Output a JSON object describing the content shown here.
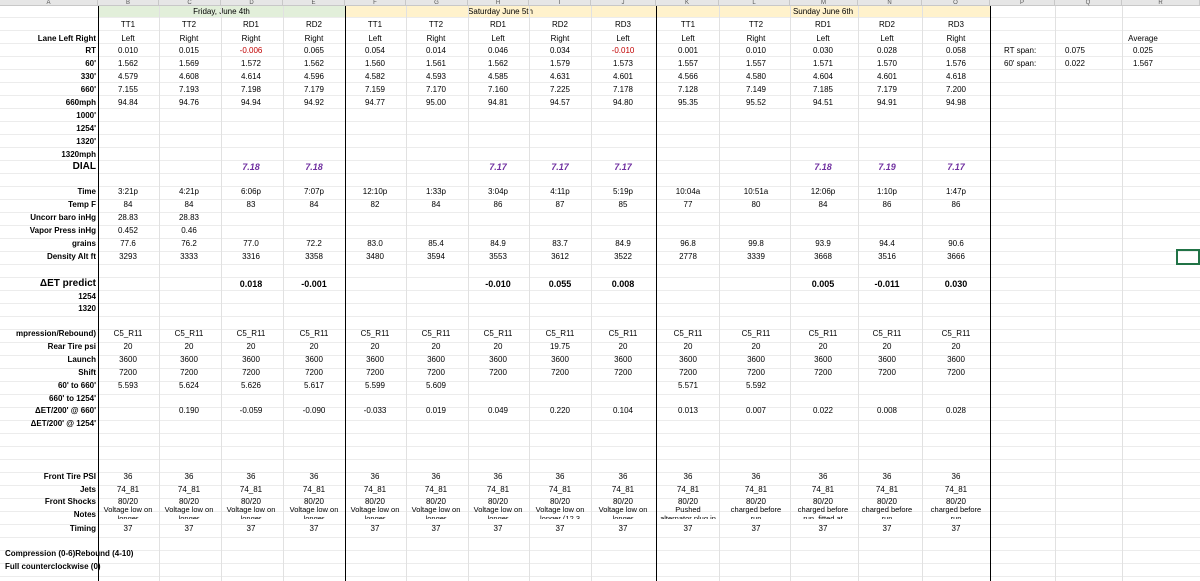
{
  "columns": [
    "A",
    "B",
    "C",
    "D",
    "E",
    "F",
    "G",
    "H",
    "I",
    "J",
    "K",
    "L",
    "M",
    "N",
    "O",
    "P",
    "Q",
    "R"
  ],
  "days": [
    {
      "label": "Friday, June 4th",
      "color": "#e2efda"
    },
    {
      "label": "Saturday June 5th",
      "color": "#fff2cc"
    },
    {
      "label": "Sunday June 6th",
      "color": "#fff2cc"
    }
  ],
  "run_headers": [
    "TT1",
    "TT2",
    "RD1",
    "RD2",
    "TT1",
    "TT2",
    "RD1",
    "RD2",
    "RD3",
    "TT1",
    "TT2",
    "RD1",
    "RD2",
    "RD3"
  ],
  "row_labels": {
    "lane": "Lane Left Right",
    "rt": "RT",
    "s60": "60'",
    "s330": "330'",
    "s660": "660'",
    "mph660": "660mph",
    "s1000": "1000'",
    "s1254": "1254'",
    "s1320": "1320'",
    "mph1320": "1320mph",
    "dial": "DIAL",
    "time": "Time",
    "temp": "Temp F",
    "baro": "Uncorr baro inHg",
    "vapor": "Vapor Press inHg",
    "grains": "grains",
    "density": "Density Alt ft",
    "et_predict": "ΔET predict",
    "r1254": "1254",
    "r1320": "1320",
    "comp": "mpression/Rebound)",
    "rear_psi": "Rear Tire psi",
    "launch": "Launch",
    "shift": "Shift",
    "s60_660": "60' to 660'",
    "s660_1254": "660' to 1254'",
    "det660": "ΔET/200' @ 660'",
    "det1254": "ΔET/200' @ 1254'",
    "front_psi": "Front Tire PSI",
    "jets": "Jets",
    "front_shocks": "Front Shocks",
    "notes": "Notes",
    "timing": "Timing"
  },
  "grid": {
    "lane": [
      "Left",
      "Right",
      "Right",
      "Right",
      "Left",
      "Right",
      "Left",
      "Right",
      "Left",
      "Left",
      "Right",
      "Left",
      "Left",
      "Right"
    ],
    "rt": [
      "0.010",
      "0.015",
      "-0.006",
      "0.065",
      "0.054",
      "0.014",
      "0.046",
      "0.034",
      "-0.010",
      "0.001",
      "0.010",
      "0.030",
      "0.028",
      "0.058"
    ],
    "s60": [
      "1.562",
      "1.569",
      "1.572",
      "1.562",
      "1.560",
      "1.561",
      "1.562",
      "1.579",
      "1.573",
      "1.557",
      "1.557",
      "1.571",
      "1.570",
      "1.576"
    ],
    "s330": [
      "4.579",
      "4.608",
      "4.614",
      "4.596",
      "4.582",
      "4.593",
      "4.585",
      "4.631",
      "4.601",
      "4.566",
      "4.580",
      "4.604",
      "4.601",
      "4.618"
    ],
    "s660": [
      "7.155",
      "7.193",
      "7.198",
      "7.179",
      "7.159",
      "7.170",
      "7.160",
      "7.225",
      "7.178",
      "7.128",
      "7.149",
      "7.185",
      "7.179",
      "7.200"
    ],
    "mph660": [
      "94.84",
      "94.76",
      "94.94",
      "94.92",
      "94.77",
      "95.00",
      "94.81",
      "94.57",
      "94.80",
      "95.35",
      "95.52",
      "94.51",
      "94.91",
      "94.98"
    ],
    "dial": [
      "",
      "",
      "7.18",
      "7.18",
      "",
      "",
      "7.17",
      "7.17",
      "7.17",
      "",
      "",
      "7.18",
      "7.19",
      "7.17"
    ],
    "time": [
      "3:21p",
      "4:21p",
      "6:06p",
      "7:07p",
      "12:10p",
      "1:33p",
      "3:04p",
      "4:11p",
      "5:19p",
      "10:04a",
      "10:51a",
      "12:06p",
      "1:10p",
      "1:47p"
    ],
    "temp": [
      "84",
      "84",
      "83",
      "84",
      "82",
      "84",
      "86",
      "87",
      "85",
      "77",
      "80",
      "84",
      "86",
      "86"
    ],
    "baro": [
      "28.83",
      "28.83",
      "",
      "",
      "",
      "",
      "",
      "",
      "",
      "",
      "",
      "",
      "",
      ""
    ],
    "vapor": [
      "0.452",
      "0.46",
      "",
      "",
      "",
      "",
      "",
      "",
      "",
      "",
      "",
      "",
      "",
      ""
    ],
    "grains": [
      "77.6",
      "76.2",
      "77.0",
      "72.2",
      "83.0",
      "85.4",
      "84.9",
      "83.7",
      "84.9",
      "96.8",
      "99.8",
      "93.9",
      "94.4",
      "90.6"
    ],
    "density": [
      "3293",
      "3333",
      "3316",
      "3358",
      "3480",
      "3594",
      "3553",
      "3612",
      "3522",
      "2778",
      "3339",
      "3668",
      "3516",
      "3666"
    ],
    "et_predict": [
      "",
      "",
      "0.018",
      "-0.001",
      "",
      "",
      "-0.010",
      "0.055",
      "0.008",
      "",
      "",
      "0.005",
      "-0.011",
      "0.030"
    ],
    "comp": [
      "C5_R11",
      "C5_R11",
      "C5_R11",
      "C5_R11",
      "C5_R11",
      "C5_R11",
      "C5_R11",
      "C5_R11",
      "C5_R11",
      "C5_R11",
      "C5_R11",
      "C5_R11",
      "C5_R11",
      "C5_R11"
    ],
    "rear_psi": [
      "20",
      "20",
      "20",
      "20",
      "20",
      "20",
      "20",
      "19.75",
      "20",
      "20",
      "20",
      "20",
      "20",
      "20"
    ],
    "launch": [
      "3600",
      "3600",
      "3600",
      "3600",
      "3600",
      "3600",
      "3600",
      "3600",
      "3600",
      "3600",
      "3600",
      "3600",
      "3600",
      "3600"
    ],
    "shift": [
      "7200",
      "7200",
      "7200",
      "7200",
      "7200",
      "7200",
      "7200",
      "7200",
      "7200",
      "7200",
      "7200",
      "7200",
      "7200",
      "7200"
    ],
    "s60_660": [
      "5.593",
      "5.624",
      "5.626",
      "5.617",
      "5.599",
      "5.609",
      "",
      "",
      "",
      "5.571",
      "5.592",
      "",
      "",
      ""
    ],
    "det660": [
      "",
      "0.190",
      "-0.059",
      "-0.090",
      "-0.033",
      "0.019",
      "0.049",
      "0.220",
      "0.104",
      "0.013",
      "0.007",
      "0.022",
      "0.008",
      "0.028"
    ],
    "front_psi": [
      "36",
      "36",
      "36",
      "36",
      "36",
      "36",
      "36",
      "36",
      "36",
      "36",
      "36",
      "36",
      "36",
      "36"
    ],
    "jets": [
      "74_81",
      "74_81",
      "74_81",
      "74_81",
      "74_81",
      "74_81",
      "74_81",
      "74_81",
      "74_81",
      "74_81",
      "74_81",
      "74_81",
      "74_81",
      "74_81"
    ],
    "front_shocks": [
      "80/20",
      "80/20",
      "80/20",
      "80/20",
      "80/20",
      "80/20",
      "80/20",
      "80/20",
      "80/20",
      "80/20",
      "80/20",
      "80/20",
      "80/20",
      "80/20"
    ],
    "notes1": [
      "Voltage low on",
      "Voltage low on",
      "Voltage low on",
      "Voltage low on",
      "Voltage low on",
      "Voltage low on",
      "Voltage low on",
      "Voltage low on",
      "Voltage low on",
      "Pushed",
      "charged before",
      "charged before",
      "charged before",
      "charged before"
    ],
    "notes2": [
      "longer",
      "longer",
      "longer",
      "longer",
      "longer",
      "longer",
      "longer",
      "longer (12.3",
      "longer",
      "alternator plug in",
      "run",
      "run, fitted at",
      "run",
      "run"
    ],
    "timing": [
      "37",
      "37",
      "37",
      "37",
      "37",
      "37",
      "37",
      "37",
      "37",
      "37",
      "37",
      "37",
      "37",
      "37"
    ]
  },
  "summary": {
    "average_label": "Average",
    "rt_span_label": "RT span:",
    "rt_span": "0.075",
    "rt_avg": "0.025",
    "s60_span_label": "60' span:",
    "s60_span": "0.022",
    "s60_avg": "1.567"
  },
  "footer": {
    "line1": "Compression (0-6)Rebound (4-10)",
    "line2": "Full counterclockwise (0)"
  },
  "colors": {
    "negative": "#c00000",
    "dial": "#7030a0",
    "selection": "#217346"
  }
}
